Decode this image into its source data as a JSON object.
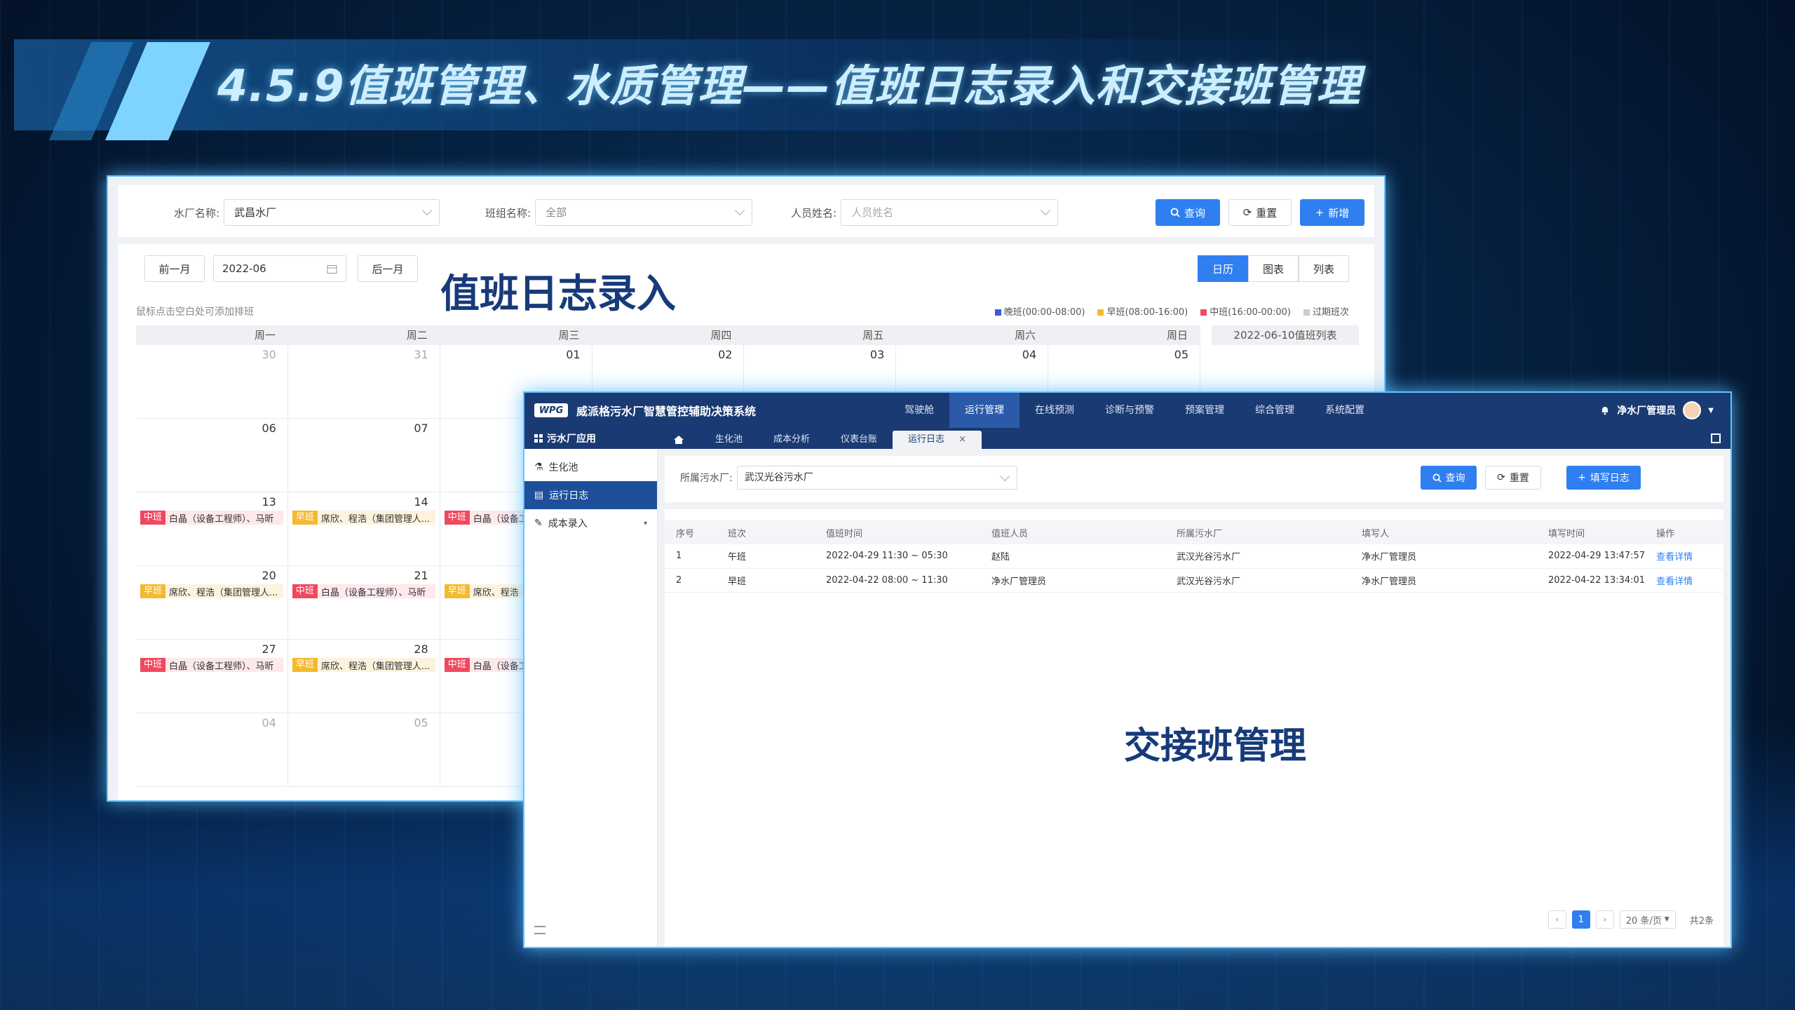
{
  "slide_title": "4.5.9值班管理、水质管理——值班日志录入和交接班管理",
  "panel1": {
    "filters": {
      "plant_label": "水厂名称:",
      "plant_value": "武昌水厂",
      "team_label": "班组名称:",
      "team_value": "全部",
      "person_label": "人员姓名:",
      "person_placeholder": "人员姓名"
    },
    "buttons": {
      "query": "查询",
      "reset": "重置",
      "add": "新增"
    },
    "prev_month": "前一月",
    "month_value": "2022-06",
    "next_month": "后一月",
    "big_label": "值班日志录入",
    "hint": "鼠标点击空白处可添加排班",
    "view_tabs": [
      "日历",
      "图表",
      "列表"
    ],
    "legend": [
      {
        "label": "晚班(00:00-08:00)",
        "color": "#3b5bd9"
      },
      {
        "label": "早班(08:00-16:00)",
        "color": "#f5b82e"
      },
      {
        "label": "中班(16:00-00:00)",
        "color": "#f0485e"
      },
      {
        "label": "过期班次",
        "color": "#cccccc"
      }
    ],
    "weekdays": [
      "周一",
      "周二",
      "周三",
      "周四",
      "周五",
      "周六",
      "周日"
    ],
    "side_list_title": "2022-06-10值班列表",
    "days": [
      {
        "d": "30",
        "dim": true
      },
      {
        "d": "31",
        "dim": true
      },
      {
        "d": "01"
      },
      {
        "d": "02"
      },
      {
        "d": "03"
      },
      {
        "d": "04"
      },
      {
        "d": "05"
      },
      {
        "d": "06"
      },
      {
        "d": "07"
      },
      {
        "d": ""
      },
      {
        "d": ""
      },
      {
        "d": ""
      },
      {
        "d": ""
      },
      {
        "d": ""
      },
      {
        "d": "13",
        "shift": "中班",
        "type": "mid",
        "text": "白晶（设备工程师）、马昕"
      },
      {
        "d": "14",
        "shift": "早班",
        "type": "early",
        "text": "席欣、程浩（集团管理人..."
      },
      {
        "d": "",
        "shift": "中班",
        "type": "mid",
        "text": "白晶（设备工程师）、马昕"
      },
      {
        "d": ""
      },
      {
        "d": ""
      },
      {
        "d": ""
      },
      {
        "d": ""
      },
      {
        "d": "20",
        "shift": "早班",
        "type": "early",
        "text": "席欣、程浩（集团管理人..."
      },
      {
        "d": "21",
        "shift": "中班",
        "type": "mid",
        "text": "白晶（设备工程师）、马昕"
      },
      {
        "d": "",
        "shift": "早班",
        "type": "early",
        "text": "席欣、程浩（集团管理人..."
      },
      {
        "d": ""
      },
      {
        "d": ""
      },
      {
        "d": ""
      },
      {
        "d": ""
      },
      {
        "d": "27",
        "shift": "中班",
        "type": "mid",
        "text": "白晶（设备工程师）、马昕"
      },
      {
        "d": "28",
        "shift": "早班",
        "type": "early",
        "text": "席欣、程浩（集团管理人..."
      },
      {
        "d": "",
        "shift": "中班",
        "type": "mid",
        "text": "白晶（设备工程师）、马昕"
      },
      {
        "d": ""
      },
      {
        "d": ""
      },
      {
        "d": ""
      },
      {
        "d": ""
      },
      {
        "d": "04",
        "dim": true
      },
      {
        "d": "05",
        "dim": true
      },
      {
        "d": ""
      },
      {
        "d": ""
      },
      {
        "d": ""
      },
      {
        "d": ""
      },
      {
        "d": ""
      }
    ]
  },
  "panel2": {
    "logo": "WPG",
    "system_name": "威派格污水厂智慧管控辅助决策系统",
    "nav": [
      "驾驶舱",
      "运行管理",
      "在线预测",
      "诊断与预警",
      "预案管理",
      "综合管理",
      "系统配置"
    ],
    "nav_active": 1,
    "user": "净水厂管理员",
    "app_title": "污水厂应用",
    "tabs": [
      "生化池",
      "成本分析",
      "仪表台账",
      "运行日志"
    ],
    "sidebar": [
      {
        "label": "生化池",
        "icon": "flask-icon"
      },
      {
        "label": "运行日志",
        "icon": "log-icon",
        "active": true
      },
      {
        "label": "成本录入",
        "icon": "edit-icon",
        "caret": "▾"
      }
    ],
    "filter_label": "所属污水厂:",
    "filter_value": "武汉光谷污水厂",
    "buttons": {
      "query": "查询",
      "reset": "重置",
      "write": "填写日志"
    },
    "columns": [
      "序号",
      "班次",
      "值班时间",
      "值班人员",
      "所属污水厂",
      "填写人",
      "填写时间",
      "操作"
    ],
    "rows": [
      [
        "1",
        "午班",
        "2022-04-29 11:30 ~ 05:30",
        "赵陆",
        "武汉光谷污水厂",
        "净水厂管理员",
        "2022-04-29 13:47:57",
        "查看详情"
      ],
      [
        "2",
        "早班",
        "2022-04-22 08:00 ~ 11:30",
        "净水厂管理员",
        "武汉光谷污水厂",
        "净水厂管理员",
        "2022-04-22 13:34:01",
        "查看详情"
      ]
    ],
    "big_label": "交接班管理",
    "pagination": {
      "current": "1",
      "page_size": "20 条/页",
      "total": "共2条"
    }
  }
}
